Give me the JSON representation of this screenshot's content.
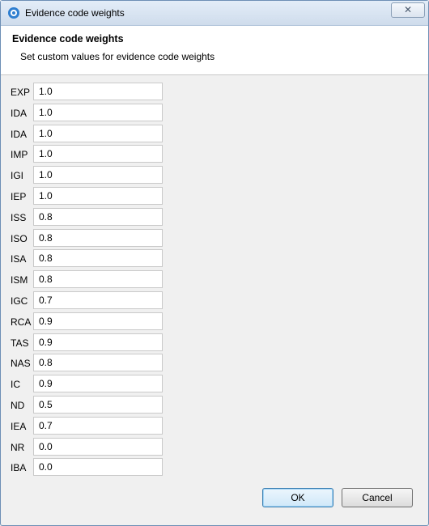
{
  "window": {
    "title": "Evidence code weights",
    "close_label": "✕"
  },
  "header": {
    "title": "Evidence code weights",
    "description": "Set custom values for evidence code weights"
  },
  "weights": [
    {
      "code": "EXP",
      "value": "1.0"
    },
    {
      "code": "IDA",
      "value": "1.0"
    },
    {
      "code": "IDA",
      "value": "1.0"
    },
    {
      "code": "IMP",
      "value": "1.0"
    },
    {
      "code": "IGI",
      "value": "1.0"
    },
    {
      "code": "IEP",
      "value": "1.0"
    },
    {
      "code": "ISS",
      "value": "0.8"
    },
    {
      "code": "ISO",
      "value": "0.8"
    },
    {
      "code": "ISA",
      "value": "0.8"
    },
    {
      "code": "ISM",
      "value": "0.8"
    },
    {
      "code": "IGC",
      "value": "0.7"
    },
    {
      "code": "RCA",
      "value": "0.9"
    },
    {
      "code": "TAS",
      "value": "0.9"
    },
    {
      "code": "NAS",
      "value": "0.8"
    },
    {
      "code": "IC",
      "value": "0.9"
    },
    {
      "code": "ND",
      "value": "0.5"
    },
    {
      "code": "IEA",
      "value": "0.7"
    },
    {
      "code": "NR",
      "value": "0.0"
    },
    {
      "code": "IBA",
      "value": "0.0"
    }
  ],
  "buttons": {
    "ok": "OK",
    "cancel": "Cancel"
  },
  "icons": {
    "title": "gear-icon",
    "close": "close-icon"
  }
}
